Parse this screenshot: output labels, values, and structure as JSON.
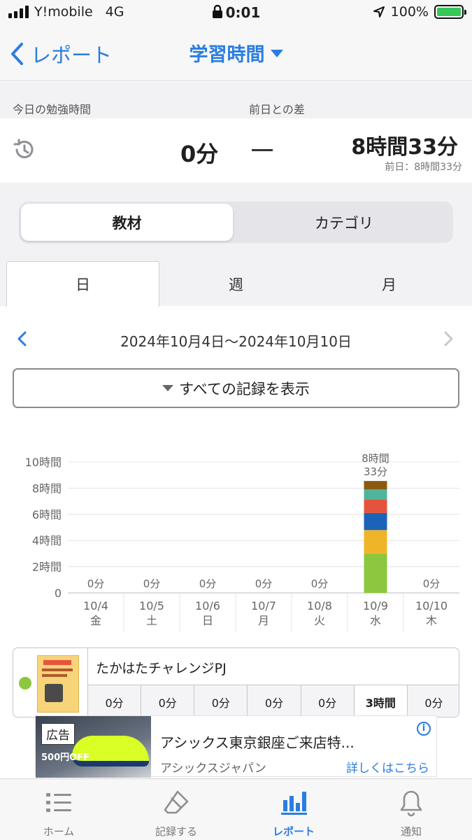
{
  "status_bar": {
    "carrier": "Y!mobile",
    "network": "4G",
    "time": "0:01",
    "battery": "100%"
  },
  "nav": {
    "back_label": "レポート",
    "title": "学習時間"
  },
  "summary": {
    "today_label": "今日の勉強時間",
    "diff_label": "前日との差",
    "today_value": "0分",
    "diff_value": "8時間33分",
    "prev_day_note": "前日：8時間33分"
  },
  "segment": {
    "options": [
      "教材",
      "カテゴリ"
    ],
    "selected": "教材"
  },
  "period_tabs": {
    "options": [
      "日",
      "週",
      "月"
    ],
    "selected": "日"
  },
  "date_range": "2024年10月4日〜2024年10月10日",
  "show_all_label": "すべての記録を表示",
  "chart_data": {
    "type": "bar",
    "stacked": true,
    "y_unit_label": "時間",
    "ylim": [
      0,
      10
    ],
    "y_ticks": [
      "0",
      "2時間",
      "4時間",
      "6時間",
      "8時間",
      "10時間"
    ],
    "categories": [
      "10/4",
      "10/5",
      "10/6",
      "10/7",
      "10/8",
      "10/9",
      "10/10"
    ],
    "weekdays": [
      "金",
      "土",
      "日",
      "月",
      "火",
      "水",
      "木"
    ],
    "totals": [
      0,
      0,
      0,
      0,
      0,
      8.55,
      0
    ],
    "total_labels": [
      "0分",
      "0分",
      "0分",
      "0分",
      "0分",
      "8時間\n33分",
      "0分"
    ],
    "series": [
      {
        "color": "#8dc63f",
        "values": [
          0,
          0,
          0,
          0,
          0,
          3.0,
          0
        ]
      },
      {
        "color": "#f0b429",
        "values": [
          0,
          0,
          0,
          0,
          0,
          1.8,
          0
        ]
      },
      {
        "color": "#1b63b8",
        "values": [
          0,
          0,
          0,
          0,
          0,
          1.3,
          0
        ]
      },
      {
        "color": "#e5533d",
        "values": [
          0,
          0,
          0,
          0,
          0,
          1.05,
          0
        ]
      },
      {
        "color": "#4fb59a",
        "values": [
          0,
          0,
          0,
          0,
          0,
          0.75,
          0
        ]
      },
      {
        "color": "#8a5a12",
        "values": [
          0,
          0,
          0,
          0,
          0,
          0.65,
          0
        ]
      }
    ],
    "grid": true
  },
  "material": {
    "title": "たかはたチャレンジPJ",
    "color": "#8dc63f",
    "daily": [
      "0分",
      "0分",
      "0分",
      "0分",
      "0分",
      "3時間",
      "0分"
    ]
  },
  "ad": {
    "tag": "広告",
    "promo": "500円OFF",
    "title": "アシックス東京銀座ご来店特...",
    "sponsor": "アシックスジャパン",
    "link": "詳しくはこちら",
    "info_glyph": "i"
  },
  "tab_bar": {
    "items": [
      {
        "label": "ホーム",
        "icon": "list-icon"
      },
      {
        "label": "記録する",
        "icon": "eraser-icon"
      },
      {
        "label": "レポート",
        "icon": "bar-chart-icon"
      },
      {
        "label": "通知",
        "icon": "bell-icon"
      }
    ],
    "selected": "レポート"
  },
  "colors": {
    "accent": "#2a7de1",
    "battery": "#36c759"
  }
}
